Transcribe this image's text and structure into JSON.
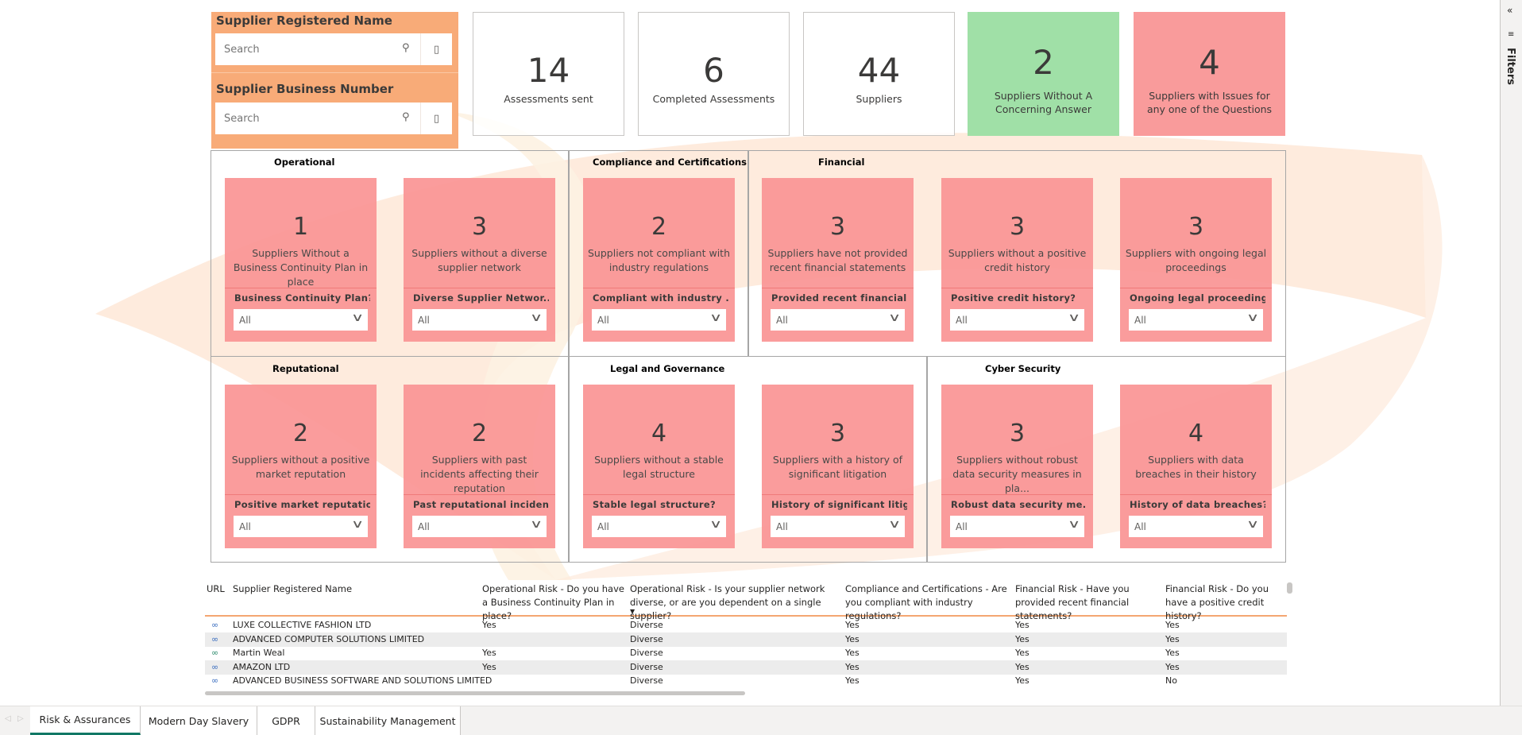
{
  "slicers": [
    {
      "title": "Supplier Registered Name",
      "placeholder": "Search"
    },
    {
      "title": "Supplier Business Number",
      "placeholder": "Search"
    }
  ],
  "kpis": [
    {
      "value": "14",
      "label": "Assessments sent",
      "style": "plain"
    },
    {
      "value": "6",
      "label": "Completed Assessments",
      "style": "plain"
    },
    {
      "value": "44",
      "label": "Suppliers",
      "style": "plain"
    },
    {
      "value": "2",
      "label": "Suppliers Without A Concerning Answer",
      "style": "green"
    },
    {
      "value": "4",
      "label": "Suppliers with Issues for any one of the Questions",
      "style": "red"
    }
  ],
  "sections": [
    "Operational",
    "Compliance and Certifications",
    "Financial",
    "Reputational",
    "Legal and Governance",
    "Cyber Security"
  ],
  "cards": [
    {
      "value": "1",
      "label": "Suppliers Without a Business Continuity Plan in place",
      "filter": "Business Continuity Plan?",
      "selected": "All"
    },
    {
      "value": "3",
      "label": "Suppliers without a diverse supplier network",
      "filter": "Diverse Supplier Networ...",
      "selected": "All"
    },
    {
      "value": "2",
      "label": "Suppliers not compliant with industry regulations",
      "filter": "Compliant with industry ...",
      "selected": "All"
    },
    {
      "value": "3",
      "label": "Suppliers have not provided recent financial statements",
      "filter": "Provided recent financial...",
      "selected": "All"
    },
    {
      "value": "3",
      "label": "Suppliers without a positive credit history",
      "filter": "Positive credit history?",
      "selected": "All"
    },
    {
      "value": "3",
      "label": "Suppliers with ongoing legal proceedings",
      "filter": "Ongoing legal proceeding...",
      "selected": "All"
    },
    {
      "value": "2",
      "label": "Suppliers without a positive market reputation",
      "filter": "Positive market reputatio...",
      "selected": "All"
    },
    {
      "value": "2",
      "label": "Suppliers with past incidents affecting their reputation",
      "filter": "Past reputational inciden...",
      "selected": "All"
    },
    {
      "value": "4",
      "label": "Suppliers without a stable legal structure",
      "filter": "Stable legal structure?",
      "selected": "All"
    },
    {
      "value": "3",
      "label": "Suppliers with a history of significant litigation",
      "filter": "History of significant litig...",
      "selected": "All"
    },
    {
      "value": "3",
      "label": "Suppliers without robust data security measures in pla...",
      "filter": "Robust data security me...",
      "selected": "All"
    },
    {
      "value": "4",
      "label": "Suppliers with data breaches in their history",
      "filter": "History of data breaches?",
      "selected": "All"
    }
  ],
  "table": {
    "columns": [
      "URL",
      "Supplier Registered Name",
      "Operational Risk - Do you have a Business Continuity Plan in place?",
      "Operational Risk - Is your supplier network diverse, or are you dependent on a single supplier?",
      "Compliance and Certifications - Are you compliant with industry regulations?",
      "Financial Risk - Have you provided recent financial statements?",
      "Financial Risk - Do you have a positive credit history?"
    ],
    "rows": [
      [
        "link",
        "LUXE COLLECTIVE FASHION LTD",
        "Yes",
        "Diverse",
        "Yes",
        "Yes",
        "Yes"
      ],
      [
        "link",
        "ADVANCED COMPUTER SOLUTIONS LIMITED",
        "",
        "Diverse",
        "Yes",
        "Yes",
        "Yes"
      ],
      [
        "link",
        "Martin Weal",
        "Yes",
        "Diverse",
        "Yes",
        "Yes",
        "Yes"
      ],
      [
        "link",
        "AMAZON LTD",
        "Yes",
        "Diverse",
        "Yes",
        "Yes",
        "Yes"
      ],
      [
        "link",
        "ADVANCED BUSINESS SOFTWARE AND SOLUTIONS LIMITED",
        "",
        "Diverse",
        "Yes",
        "Yes",
        "No"
      ]
    ]
  },
  "tabs": [
    {
      "label": "Risk & Assurances",
      "active": true
    },
    {
      "label": "Modern Day Slavery"
    },
    {
      "label": "GDPR"
    },
    {
      "label": "Sustainability Management"
    }
  ],
  "filters_pane": {
    "label": "Filters"
  },
  "colors": {
    "slicer_bg": "#f8ab78",
    "alert": "#f99b9b",
    "ok": "#a0e0a7",
    "active_tab": "#117865"
  }
}
